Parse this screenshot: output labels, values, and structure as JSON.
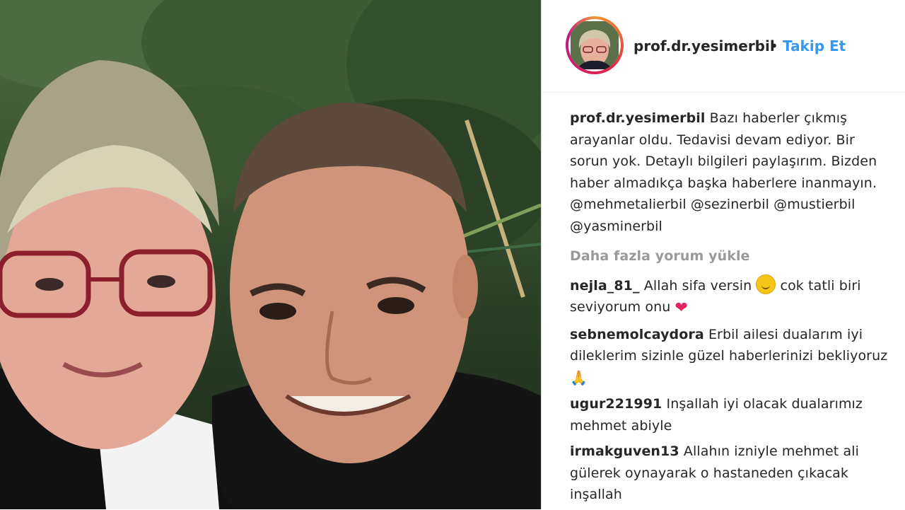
{
  "header": {
    "username": "prof.dr.yesimerbil",
    "separator": "•",
    "follow_label": "Takip Et"
  },
  "post": {
    "author": "prof.dr.yesimerbil",
    "caption": " Bazı haberler çıkmış arayanlar oldu. Tedavisi devam ediyor. Bir sorun yok. Detaylı bilgileri paylaşırım. Bizden haber almadıkça başka haberlere inanmayın. ",
    "mentions": [
      "@mehmetalierbil",
      "@sezinerbil",
      "@mustierbil",
      "@yasminerbil"
    ]
  },
  "load_more_label": "Daha fazla yorum yükle",
  "comments": [
    {
      "user": "nejla_81_",
      "text_a": " Allah sifa versin ",
      "emoji_a": "smiling-face-emoji",
      "text_b": " cok tatli biri seviyorum onu ",
      "emoji_b": "❤"
    },
    {
      "user": "sebnemolcaydora",
      "text": " Erbil ailesi dualarım iyi dileklerim sizinle güzel haberlerinizi bekliyoruz ",
      "emoji": "🙏"
    },
    {
      "user": "ugur221991",
      "text": " Inşallah iyi olacak dualarımız mehmet abiyle"
    },
    {
      "user": "irmakguven13",
      "text": " Allahın izniyle mehmet ali gülerek oynayarak o hastaneden çıkacak inşallah"
    }
  ],
  "colors": {
    "link": "#3897f0",
    "text": "#262626",
    "muted": "#999999"
  }
}
